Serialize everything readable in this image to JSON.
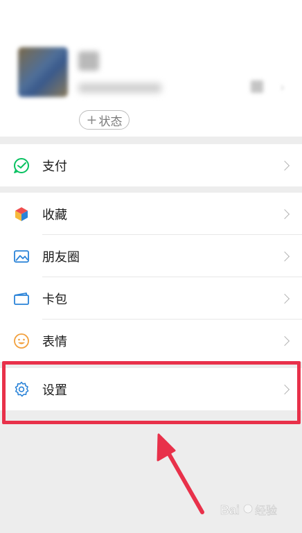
{
  "profile": {
    "status_button_label": "状态",
    "status_plus": "+"
  },
  "menu": {
    "pay": {
      "label": "支付",
      "icon": "pay-icon"
    },
    "favorites": {
      "label": "收藏",
      "icon": "favorites-cube-icon"
    },
    "moments": {
      "label": "朋友圈",
      "icon": "moments-image-icon"
    },
    "cards": {
      "label": "卡包",
      "icon": "card-wallet-icon"
    },
    "stickers": {
      "label": "表情",
      "icon": "smiley-icon"
    },
    "settings": {
      "label": "设置",
      "icon": "gear-icon"
    }
  },
  "annotation": {
    "highlight_color": "#e8314a",
    "arrow_color": "#e8314a"
  },
  "colors": {
    "accent_green": "#07c160",
    "accent_blue": "#2a83d8",
    "accent_orange": "#f2a03d"
  }
}
